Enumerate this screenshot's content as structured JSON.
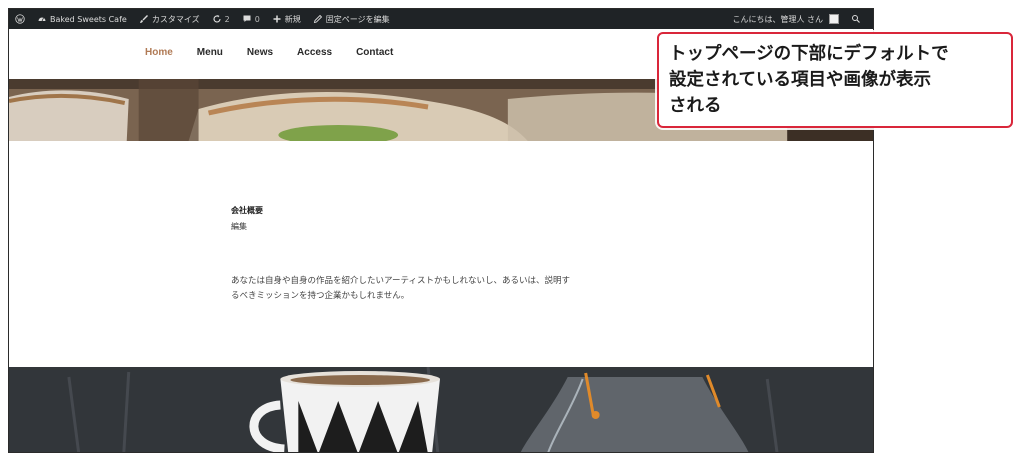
{
  "adminbar": {
    "items_left": [
      {
        "icon": "wordpress-logo-icon",
        "label": ""
      },
      {
        "icon": "dashboard-gauge-icon",
        "label": "Baked Sweets Cafe"
      },
      {
        "icon": "paintbrush-icon",
        "label": "カスタマイズ"
      },
      {
        "icon": "update-refresh-icon",
        "label": "2"
      },
      {
        "icon": "comment-bubble-icon",
        "label": "0"
      },
      {
        "icon": "plus-icon",
        "label": "新規"
      },
      {
        "icon": "pencil-icon",
        "label": "固定ページを編集"
      }
    ],
    "greeting": "こんにちは、管理人 さん",
    "search_icon": "search-icon",
    "colors": {
      "bar": "#1f2326",
      "text": "#dcdcdc"
    }
  },
  "nav": {
    "items": [
      "Home",
      "Menu",
      "News",
      "Access",
      "Contact"
    ],
    "active": "Home",
    "active_color": "#b07a55"
  },
  "content": {
    "title": "会社概要",
    "edit_link": "編集",
    "body_line1": "あなたは自身や自身の作品を紹介したいアーティストかもしれないし、あるいは、説明す",
    "body_line2": "るべきミッションを持つ企業かもしれません。"
  },
  "callout": {
    "text_line1": "トップページの下部にデフォルトで",
    "text_line2": "設定されている項目や画像が表示",
    "text_line3": "される",
    "border_color": "#d9263a"
  }
}
